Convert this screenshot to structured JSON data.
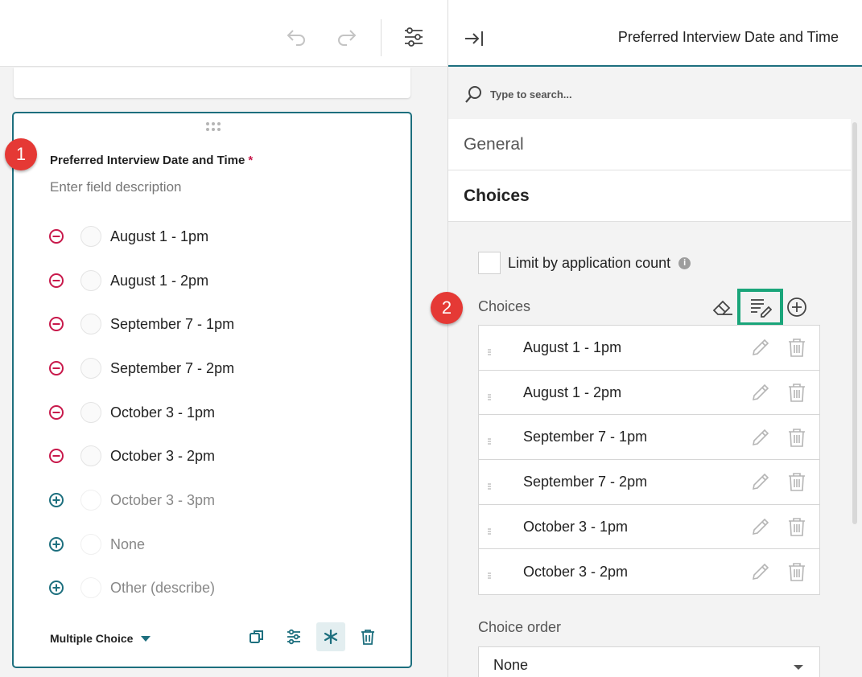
{
  "toolbar": {
    "undo_icon": "undo-icon",
    "redo_icon": "redo-icon",
    "settings_icon": "sliders-icon"
  },
  "question": {
    "label": "Preferred Interview Date and Time",
    "required_mark": "*",
    "description_placeholder": "Enter field description",
    "options": [
      {
        "label": "August 1 - 1pm",
        "action": "remove"
      },
      {
        "label": "August 1 - 2pm",
        "action": "remove"
      },
      {
        "label": "September 7 - 1pm",
        "action": "remove"
      },
      {
        "label": "September 7 - 2pm",
        "action": "remove"
      },
      {
        "label": "October 3 - 1pm",
        "action": "remove"
      },
      {
        "label": "October 3 - 2pm",
        "action": "remove"
      },
      {
        "label": "October 3 - 3pm",
        "action": "add"
      },
      {
        "label": "None",
        "action": "add"
      },
      {
        "label": "Other (describe)",
        "action": "add"
      }
    ],
    "type_label": "Multiple Choice"
  },
  "badges": {
    "one": "1",
    "two": "2"
  },
  "panel": {
    "title": "Preferred Interview Date and Time",
    "search_placeholder": "Type to search...",
    "sections": {
      "general": "General",
      "choices": "Choices"
    },
    "limit_label": "Limit by application count",
    "choices_label": "Choices",
    "choices": [
      "August 1 - 1pm",
      "August 1 - 2pm",
      "September 7 - 1pm",
      "September 7 - 2pm",
      "October 3 - 1pm",
      "October 3 - 2pm"
    ],
    "choice_order_label": "Choice order",
    "choice_order_value": "None"
  },
  "colors": {
    "accent": "#1d6f7e",
    "remove": "#c8194b",
    "badge": "#e53935",
    "highlight": "#1aa57a"
  }
}
